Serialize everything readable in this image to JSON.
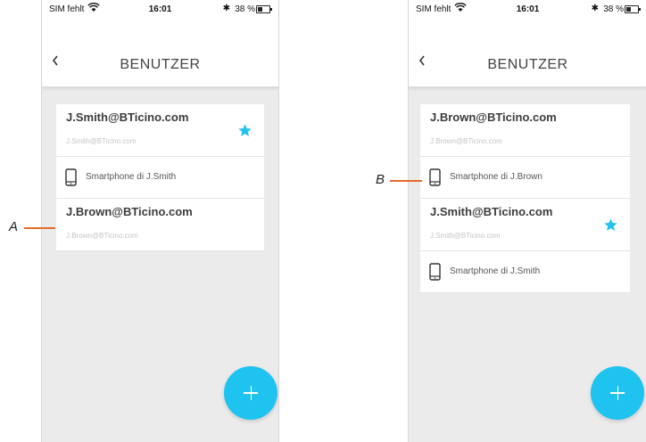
{
  "colors": {
    "accent": "#1ec3ef",
    "callout_line": "#e36b2e",
    "background": "#ebebeb"
  },
  "status_bar": {
    "carrier": "SIM fehlt",
    "time": "16:01",
    "bluetooth": "✱",
    "battery": "38 %",
    "battery_level": 0.38,
    "icons": [
      "wifi-icon",
      "bluetooth-icon",
      "battery-icon"
    ]
  },
  "screens": [
    {
      "title": "BENUTZER",
      "back_icon": "chevron-left-icon",
      "users": [
        {
          "email": "J.Smith@BTicino.com",
          "subtitle": "J.Smith@BTicino.com",
          "favorite": true,
          "device": "Smartphone di J.Smith"
        },
        {
          "email": "J.Brown@BTicino.com",
          "subtitle": "J.Brown@BTicino.com",
          "favorite": false
        }
      ],
      "add_icon": "plus-icon"
    },
    {
      "title": "BENUTZER",
      "back_icon": "chevron-left-icon",
      "users": [
        {
          "email": "J.Brown@BTicino.com",
          "subtitle": "J.Brown@BTicino.com",
          "favorite": false,
          "device": "Smartphone di J.Brown"
        },
        {
          "email": "J.Smith@BTicino.com",
          "subtitle": "J.Smith@BTicino.com",
          "favorite": true,
          "device": "Smartphone di J.Smith"
        }
      ],
      "add_icon": "plus-icon"
    }
  ],
  "callouts": {
    "a": "A",
    "b": "B"
  }
}
